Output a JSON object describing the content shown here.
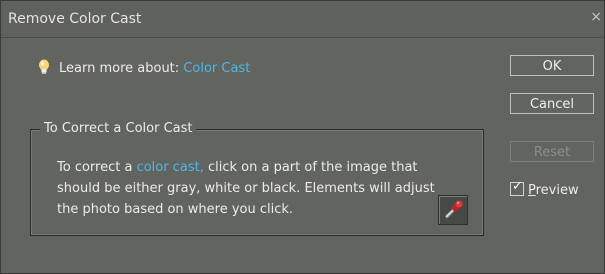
{
  "dialog": {
    "title": "Remove Color Cast",
    "close_glyph": "×"
  },
  "learn_more": {
    "label": "Learn more about:",
    "link": "Color Cast",
    "icon": "lightbulb-icon"
  },
  "group": {
    "title": "To Correct a Color Cast",
    "body_prefix": "To correct a ",
    "body_link": "color cast,",
    "body_suffix": " click on a part of the image that should be either gray, white or black. Elements will adjust the photo based on where you click.",
    "tool_icon": "eyedropper-icon"
  },
  "buttons": {
    "ok": "OK",
    "cancel": "Cancel",
    "reset": "Reset"
  },
  "preview": {
    "mnemonic": "P",
    "rest": "review",
    "checked": true,
    "check_glyph": "✓"
  },
  "colors": {
    "link": "#4ab8e8",
    "background": "#626460"
  }
}
